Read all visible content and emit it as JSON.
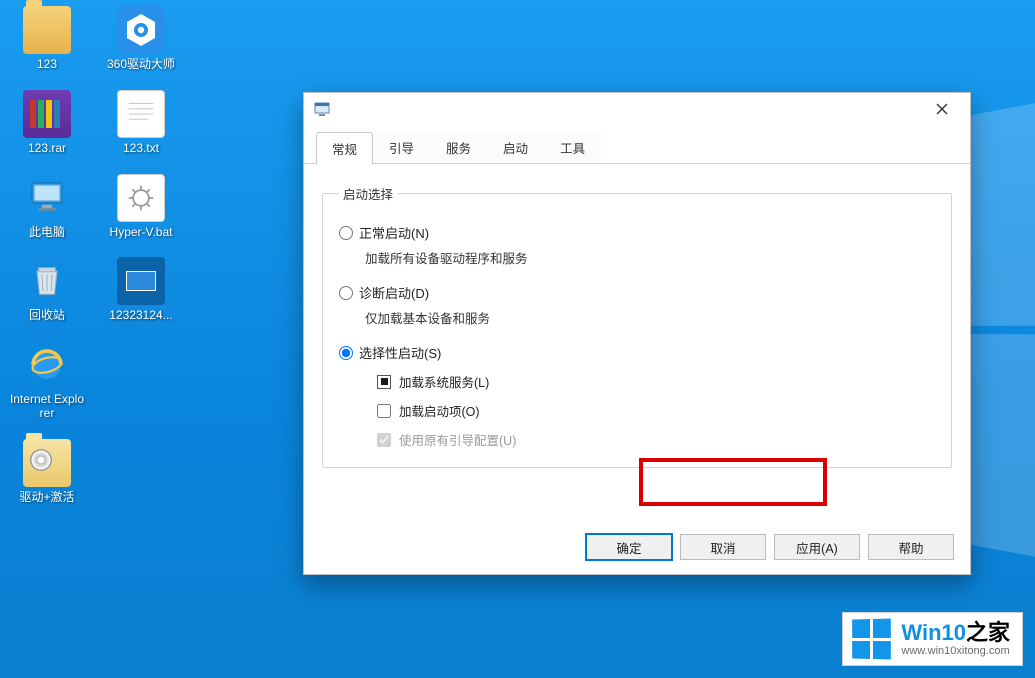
{
  "desktop_icons": {
    "c1": [
      {
        "name": "123"
      },
      {
        "name": "123.rar"
      },
      {
        "name": "此电脑"
      },
      {
        "name": "回收站"
      },
      {
        "name": "Internet Explorer"
      },
      {
        "name": "驱动+激活"
      }
    ],
    "c2": [
      {
        "name": "360驱动大师"
      },
      {
        "name": "123.txt"
      },
      {
        "name": "Hyper-V.bat"
      },
      {
        "name": "12323124..."
      }
    ]
  },
  "dialog": {
    "tabs": [
      "常规",
      "引导",
      "服务",
      "启动",
      "工具"
    ],
    "active_tab_index": 0,
    "groupbox_title": "启动选择",
    "radio_normal": "正常启动(N)",
    "radio_normal_desc": "加载所有设备驱动程序和服务",
    "radio_diag": "诊断启动(D)",
    "radio_diag_desc": "仅加载基本设备和服务",
    "radio_selective": "选择性启动(S)",
    "chk_load_services": "加载系统服务(L)",
    "chk_load_startup": "加载启动项(O)",
    "chk_use_original_boot": "使用原有引导配置(U)",
    "selected_radio": "selective",
    "chk_services_state": "indeterminate",
    "chk_startup_state": "unchecked",
    "chk_boot_state": "checked_disabled",
    "buttons": {
      "ok": "确定",
      "cancel": "取消",
      "apply": "应用(A)",
      "help": "帮助"
    }
  },
  "watermark": {
    "title": "Win10",
    "suffix": "之家",
    "url": "www.win10xitong.com"
  }
}
